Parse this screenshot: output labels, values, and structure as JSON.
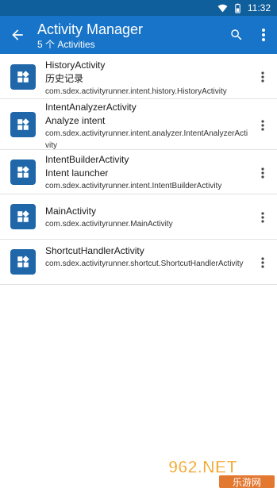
{
  "status_bar": {
    "time": "11:32"
  },
  "app_bar": {
    "title": "Activity Manager",
    "subtitle": "5 个 Activities"
  },
  "activities": [
    {
      "name": "HistoryActivity",
      "label": "历史记录",
      "package": "com.sdex.activityrunner.intent.history.HistoryActivity"
    },
    {
      "name": "IntentAnalyzerActivity",
      "label": "Analyze intent",
      "package": "com.sdex.activityrunner.intent.analyzer.IntentAnalyzerActivity"
    },
    {
      "name": "IntentBuilderActivity",
      "label": "Intent launcher",
      "package": "com.sdex.activityrunner.intent.IntentBuilderActivity"
    },
    {
      "name": "MainActivity",
      "label": "",
      "package": "com.sdex.activityrunner.MainActivity"
    },
    {
      "name": "ShortcutHandlerActivity",
      "label": "",
      "package": "com.sdex.activityrunner.shortcut.ShortcutHandlerActivity"
    }
  ],
  "watermark": {
    "main": "962.NET",
    "sub": "乐游网"
  },
  "colors": {
    "status_bar": "#0f5f9c",
    "app_bar": "#1874c8",
    "icon_bg": "#1f67a8"
  },
  "icons": {
    "back": "arrow-left-icon",
    "search": "search-icon",
    "more": "more-vert-icon",
    "app": "widgets-icon",
    "wifi": "wifi-icon",
    "battery": "battery-icon"
  }
}
